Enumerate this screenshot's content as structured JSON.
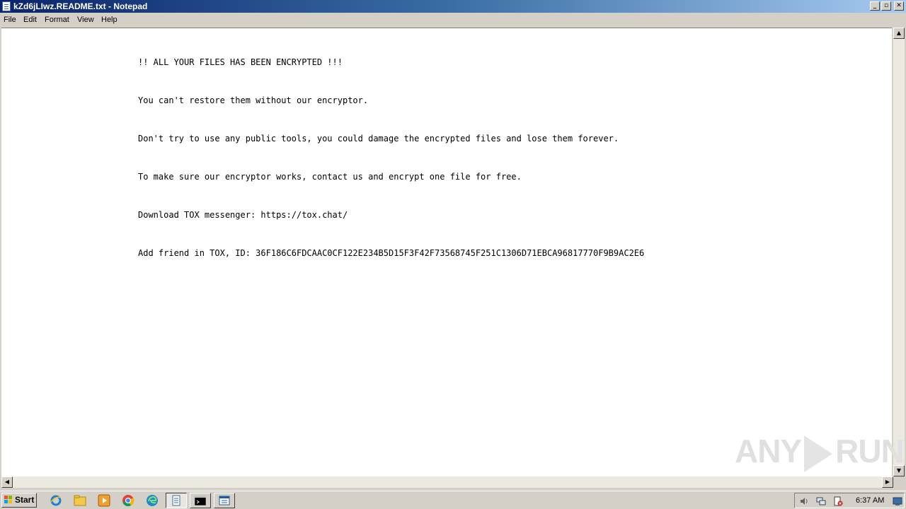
{
  "window": {
    "title": "kZd6jLIwz.README.txt - Notepad"
  },
  "menubar": {
    "items": [
      "File",
      "Edit",
      "Format",
      "View",
      "Help"
    ]
  },
  "document": {
    "lines": [
      "!! ALL YOUR FILES HAS BEEN ENCRYPTED !!!",
      "You can't restore them without our encryptor.",
      "Don't try to use any public tools, you could damage the encrypted files and lose them forever.",
      "To make sure our encryptor works, contact us and encrypt one file for free.",
      "Download TOX messenger: https://tox.chat/",
      "Add friend in TOX, ID: 36F186C6FDCAAC0CF122E234B5D15F3F42F73568745F251C1306D71EBCA96817770F9B9AC2E6"
    ]
  },
  "watermark": {
    "left": "ANY",
    "right": "RUN"
  },
  "taskbar": {
    "start_label": "Start",
    "clock": "6:37 AM"
  },
  "colors": {
    "title_gradient_start": "#0a246a",
    "title_gradient_end": "#a6caf0",
    "chrome": "#d4d0c8"
  }
}
